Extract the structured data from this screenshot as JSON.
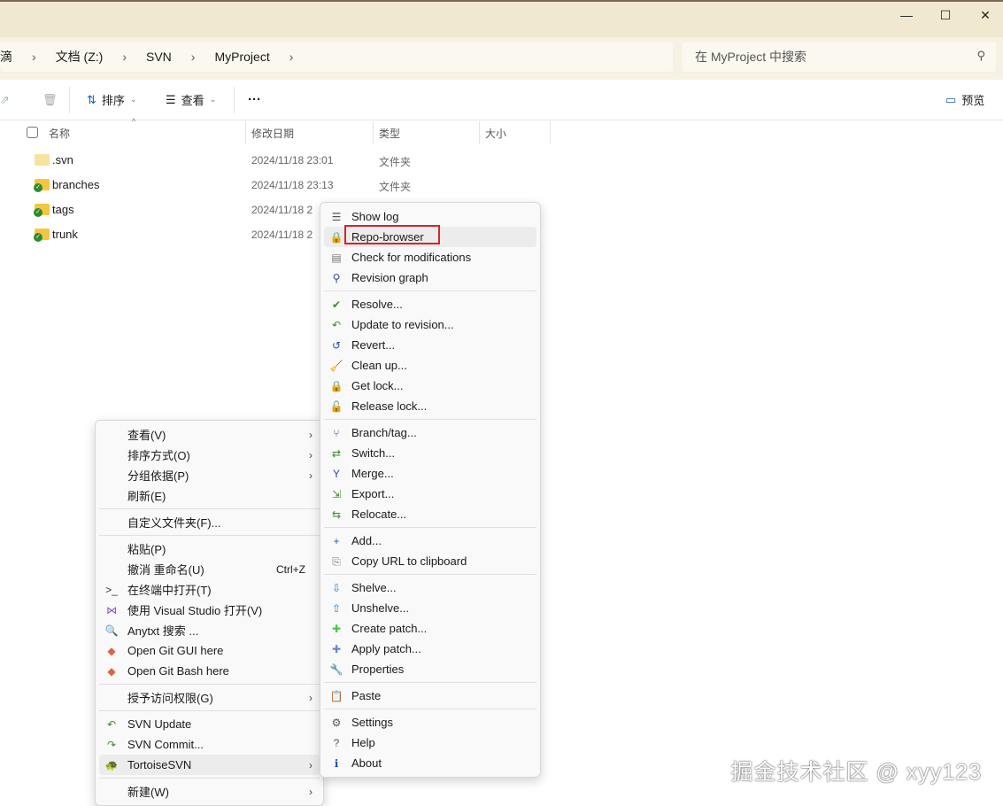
{
  "window": {
    "minimize": "—",
    "maximize": "☐",
    "close": "✕"
  },
  "breadcrumb": {
    "items": [
      "滴",
      "文档 (Z:)",
      "SVN",
      "MyProject"
    ],
    "sep": "›"
  },
  "search": {
    "placeholder": "在 MyProject 中搜索",
    "icon": "search-icon"
  },
  "toolbar": {
    "sort": "排序",
    "view": "查看",
    "more": "···",
    "preview": "预览"
  },
  "columns": {
    "name": "名称",
    "modified": "修改日期",
    "type": "类型",
    "size": "大小"
  },
  "files": [
    {
      "name": ".svn",
      "modified": "2024/11/18 23:01",
      "type": "文件夹",
      "status": "plain"
    },
    {
      "name": "branches",
      "modified": "2024/11/18 23:13",
      "type": "文件夹",
      "status": "ok"
    },
    {
      "name": "tags",
      "modified": "2024/11/18 2",
      "type": "",
      "status": "ok"
    },
    {
      "name": "trunk",
      "modified": "2024/11/18 2",
      "type": "",
      "status": "ok"
    }
  ],
  "context_menu": [
    {
      "label": "查看(V)",
      "arrow": true
    },
    {
      "label": "排序方式(O)",
      "arrow": true
    },
    {
      "label": "分组依据(P)",
      "arrow": true
    },
    {
      "label": "刷新(E)"
    },
    {
      "sep": true
    },
    {
      "label": "自定义文件夹(F)..."
    },
    {
      "sep": true
    },
    {
      "label": "粘贴(P)"
    },
    {
      "label": "撤消 重命名(U)",
      "shortcut": "Ctrl+Z"
    },
    {
      "label": "在终端中打开(T)",
      "icon": "terminal-icon",
      "glyph": ">_",
      "color": "#333"
    },
    {
      "label": "使用 Visual Studio 打开(V)",
      "icon": "visual-studio-icon",
      "glyph": "⋈",
      "color": "#8a4fd1"
    },
    {
      "label": "Anytxt 搜索 ...",
      "icon": "anytxt-search-icon",
      "glyph": "🔍",
      "color": "#3a7"
    },
    {
      "label": "Open Git GUI here",
      "icon": "git-gui-icon",
      "glyph": "◆",
      "color": "#e0604a"
    },
    {
      "label": "Open Git Bash here",
      "icon": "git-bash-icon",
      "glyph": "◆",
      "color": "#e0604a"
    },
    {
      "sep": true
    },
    {
      "label": "授予访问权限(G)",
      "arrow": true
    },
    {
      "sep": true
    },
    {
      "label": "SVN Update",
      "icon": "svn-update-icon",
      "glyph": "↶",
      "color": "#3a8a2a"
    },
    {
      "label": "SVN Commit...",
      "icon": "svn-commit-icon",
      "glyph": "↷",
      "color": "#3a8a2a"
    },
    {
      "label": "TortoiseSVN",
      "icon": "tortoisesvn-icon",
      "glyph": "🐢",
      "color": "#6a8",
      "arrow": true,
      "highlight": true
    },
    {
      "sep": true
    },
    {
      "label": "新建(W)",
      "arrow": true
    }
  ],
  "tortoise_menu": [
    {
      "label": "Show log",
      "icon": "show-log-icon",
      "glyph": "☰",
      "color": "#555"
    },
    {
      "label": "Repo-browser",
      "icon": "repo-browser-icon",
      "glyph": "🔒",
      "color": "#c9a400",
      "highlight": true
    },
    {
      "label": "Check for modifications",
      "icon": "check-modifications-icon",
      "glyph": "▤",
      "color": "#777"
    },
    {
      "label": "Revision graph",
      "icon": "revision-graph-icon",
      "glyph": "⚲",
      "color": "#2a4a9a"
    },
    {
      "sep": true
    },
    {
      "label": "Resolve...",
      "icon": "resolve-icon",
      "glyph": "✔",
      "color": "#3a8a2a"
    },
    {
      "label": "Update to revision...",
      "icon": "update-revision-icon",
      "glyph": "↶",
      "color": "#3a8a2a"
    },
    {
      "label": "Revert...",
      "icon": "revert-icon",
      "glyph": "↺",
      "color": "#1a4fb0"
    },
    {
      "label": "Clean up...",
      "icon": "cleanup-icon",
      "glyph": "🧹",
      "color": "#a66"
    },
    {
      "label": "Get lock...",
      "icon": "lock-icon",
      "glyph": "🔒",
      "color": "#c9a400"
    },
    {
      "label": "Release lock...",
      "icon": "unlock-icon",
      "glyph": "🔓",
      "color": "#c9a400"
    },
    {
      "sep": true
    },
    {
      "label": "Branch/tag...",
      "icon": "branch-tag-icon",
      "glyph": "⑂",
      "color": "#2a4a9a"
    },
    {
      "label": "Switch...",
      "icon": "switch-icon",
      "glyph": "⇄",
      "color": "#3a8a2a"
    },
    {
      "label": "Merge...",
      "icon": "merge-icon",
      "glyph": "Y",
      "color": "#2a4a9a"
    },
    {
      "label": "Export...",
      "icon": "export-icon",
      "glyph": "⇲",
      "color": "#3a8a2a"
    },
    {
      "label": "Relocate...",
      "icon": "relocate-icon",
      "glyph": "⇆",
      "color": "#3a8a2a"
    },
    {
      "sep": true
    },
    {
      "label": "Add...",
      "icon": "add-icon",
      "glyph": "+",
      "color": "#1a5fd0"
    },
    {
      "label": "Copy URL to clipboard",
      "icon": "copy-url-icon",
      "glyph": "⎘",
      "color": "#777"
    },
    {
      "sep": true
    },
    {
      "label": "Shelve...",
      "icon": "shelve-icon",
      "glyph": "⇩",
      "color": "#1a7fd0"
    },
    {
      "label": "Unshelve...",
      "icon": "unshelve-icon",
      "glyph": "⇧",
      "color": "#1a7fd0"
    },
    {
      "label": "Create patch...",
      "icon": "create-patch-icon",
      "glyph": "✚",
      "color": "#4c4"
    },
    {
      "label": "Apply patch...",
      "icon": "apply-patch-icon",
      "glyph": "✚",
      "color": "#68c"
    },
    {
      "label": "Properties",
      "icon": "properties-icon",
      "glyph": "🔧",
      "color": "#777"
    },
    {
      "sep": true
    },
    {
      "label": "Paste",
      "icon": "paste-icon",
      "glyph": "📋",
      "color": "#777"
    },
    {
      "sep": true
    },
    {
      "label": "Settings",
      "icon": "settings-icon",
      "glyph": "⚙",
      "color": "#555"
    },
    {
      "label": "Help",
      "icon": "help-icon",
      "glyph": "?",
      "color": "#555"
    },
    {
      "label": "About",
      "icon": "about-icon",
      "glyph": "ℹ",
      "color": "#1a4fb0"
    }
  ],
  "watermark": "掘金技术社区 @ xyy123"
}
